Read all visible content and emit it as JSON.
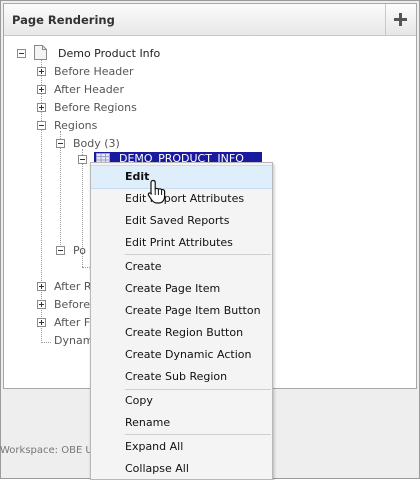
{
  "panel": {
    "title": "Page Rendering",
    "add_button_icon": "plus-icon"
  },
  "tree": {
    "root": "Demo Product Info",
    "nodes": {
      "before_header": "Before Header",
      "after_header": "After Header",
      "before_regions": "Before Regions",
      "regions": "Regions",
      "body": "Body (3)",
      "selected": "DEMO_PRODUCT_INFO",
      "post_partial": "Po",
      "after_partial": "After R",
      "before_partial": "Before",
      "after_f_partial": "After Fo",
      "dynamic_partial": "Dynam"
    }
  },
  "footer": {
    "workspace": "Workspace: OBE U"
  },
  "context_menu": {
    "items": [
      "Edit",
      "Edit Report Attributes",
      "Edit Saved Reports",
      "Edit Print Attributes",
      "Create",
      "Create Page Item",
      "Create Page Item Button",
      "Create Region Button",
      "Create Dynamic Action",
      "Create Sub Region",
      "Copy",
      "Rename",
      "Expand All",
      "Collapse All"
    ]
  }
}
